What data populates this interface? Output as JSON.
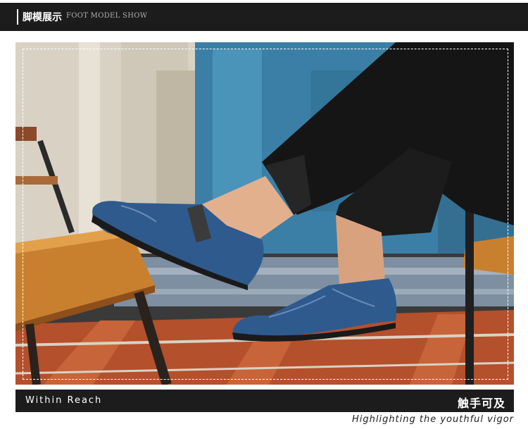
{
  "header": {
    "title_cn": "脚模展示",
    "title_en": "FOOT MODEL SHOW"
  },
  "photo": {
    "subject": "model-shot-blue-leather-loafers"
  },
  "caption": {
    "left_en": "Within Reach",
    "right_cn": "触手可及"
  },
  "tagline": "Highlighting the youthful vigor",
  "colors": {
    "bar": "#1c1c1c",
    "shoe_blue": "#2f5a8e",
    "wall_blue": "#3c7fa6",
    "floor_red": "#b4502c"
  }
}
